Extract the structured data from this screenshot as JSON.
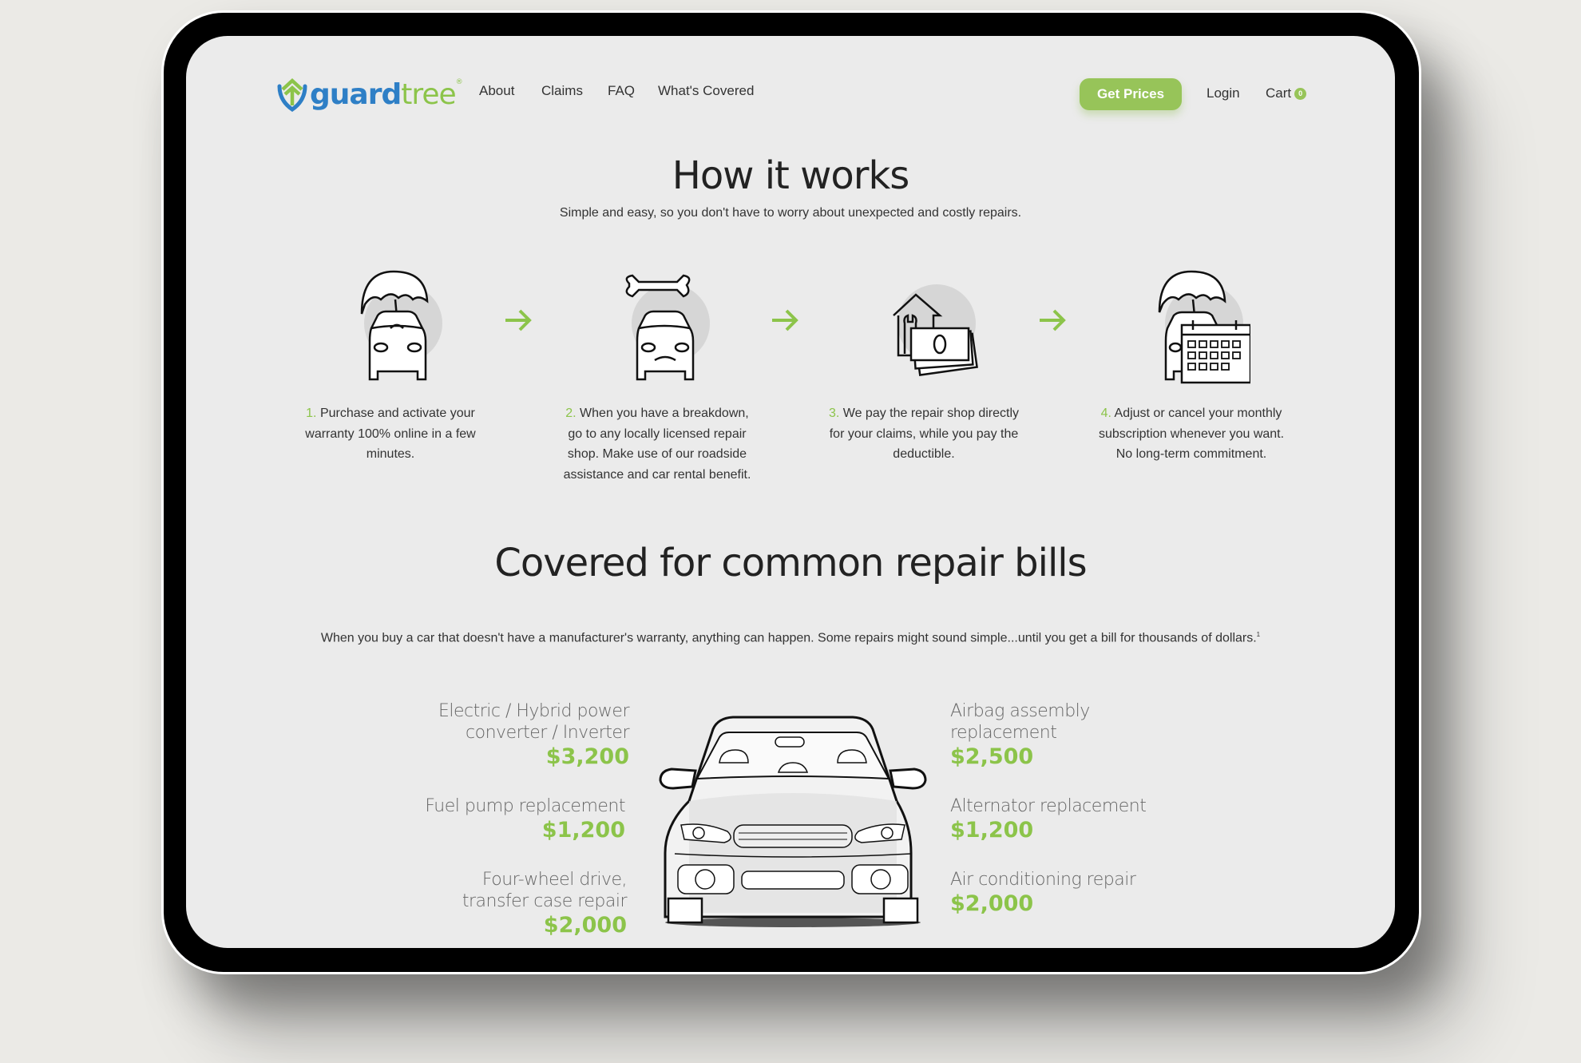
{
  "brand": {
    "name_part1": "guard",
    "name_part2": "tree",
    "trademark": "®",
    "colors": {
      "blue": "#2e7fc6",
      "green": "#8cc44a"
    }
  },
  "nav": {
    "items": [
      {
        "label": "About"
      },
      {
        "label": "Claims"
      },
      {
        "label": "FAQ"
      },
      {
        "label": "What's Covered"
      }
    ]
  },
  "header": {
    "cta_label": "Get Prices",
    "login_label": "Login",
    "cart_label": "Cart",
    "cart_count": "0",
    "accent": "#97c459"
  },
  "how_it_works": {
    "title": "How it works",
    "subtitle": "Simple and easy, so you don't have to worry about unexpected and costly repairs.",
    "steps": [
      {
        "num": "1.",
        "text": " Purchase and activate your warranty 100% online in a few minutes.",
        "icon": "car-umbrella-icon"
      },
      {
        "num": "2.",
        "text": " When you have a breakdown, go to any locally licensed repair shop. Make use of our roadside assistance and car rental benefit.",
        "icon": "car-wrench-icon"
      },
      {
        "num": "3.",
        "text": " We pay the repair shop directly for your claims, while you pay the deductible.",
        "icon": "shop-money-icon"
      },
      {
        "num": "4.",
        "text": " Adjust or cancel your monthly subscription whenever you want. No long-term commitment.",
        "icon": "car-calendar-icon"
      }
    ]
  },
  "covered": {
    "title": "Covered for common repair bills",
    "paragraph": "When you buy a car that doesn't have a manufacturer's warranty, anything can happen. Some repairs might sound simple...until you get a bill for thousands of dollars.",
    "footnote": "1",
    "left_items": [
      {
        "label": "Electric / Hybrid power converter / Inverter",
        "price": "$3,200"
      },
      {
        "label": "Fuel pump replacement",
        "price": "$1,200"
      },
      {
        "label": "Four-wheel drive, transfer case repair",
        "price": "$2,000"
      }
    ],
    "right_items": [
      {
        "label": "Airbag assembly replacement",
        "price": "$2,500"
      },
      {
        "label": "Alternator replacement",
        "price": "$1,200"
      },
      {
        "label": "Air conditioning repair",
        "price": "$2,000"
      }
    ]
  }
}
